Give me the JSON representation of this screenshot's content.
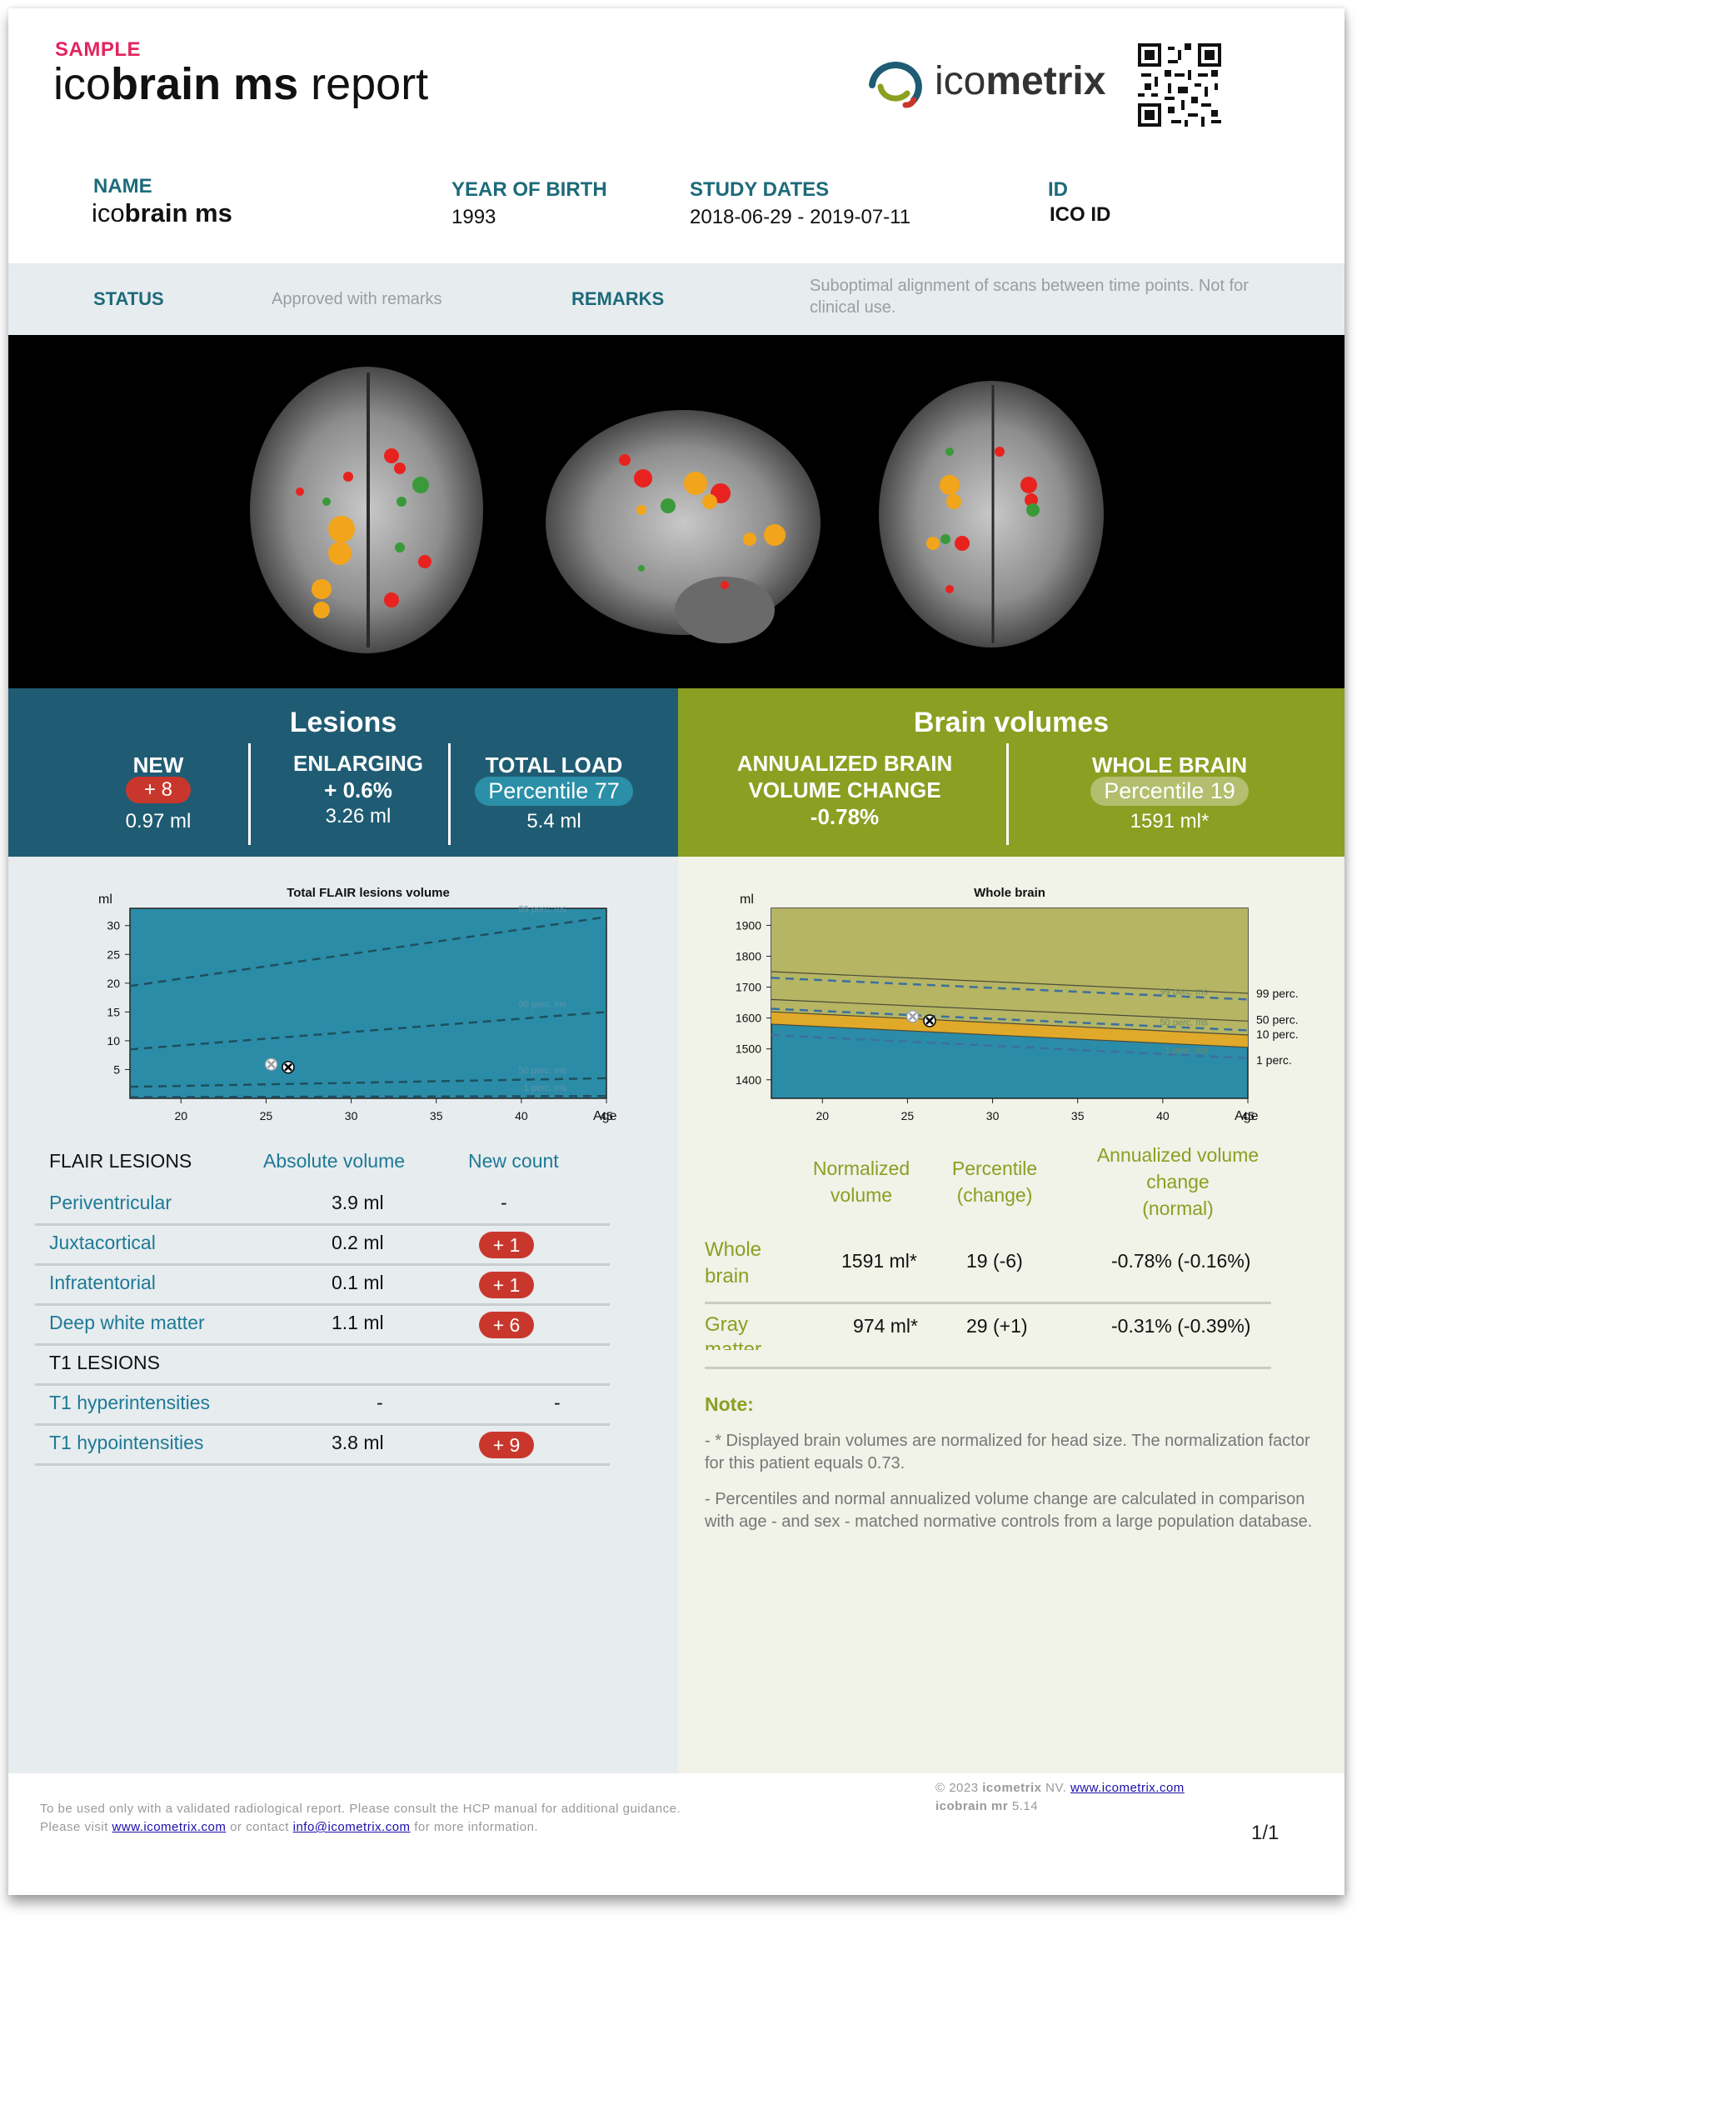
{
  "header": {
    "sample": "SAMPLE",
    "title_light": "ico",
    "title_bold": "brain ms",
    "title_tail": " report",
    "brand_light": "ico",
    "brand_bold": "metrix"
  },
  "patient": {
    "name_label": "NAME",
    "name_light": "ico",
    "name_bold": "brain ms",
    "yob_label": "YEAR OF BIRTH",
    "yob_value": "1993",
    "dates_label": "STUDY DATES",
    "dates_value": "2018-06-29 - 2019-07-11",
    "id_label": "ID",
    "id_value": "ICO ID"
  },
  "status": {
    "status_label": "STATUS",
    "status_value": "Approved with remarks",
    "remarks_label": "REMARKS",
    "remarks_value": "Suboptimal alignment of scans between time points. Not for clinical use."
  },
  "lesions_header": {
    "title": "Lesions",
    "new_label": "NEW",
    "new_badge": "+ 8",
    "new_volume": "0.97 ml",
    "enl_label": "ENLARGING",
    "enl_value": "+ 0.6%",
    "enl_volume": "3.26 ml",
    "total_label": "TOTAL LOAD",
    "total_badge": "Percentile 77",
    "total_volume": "5.4 ml"
  },
  "brain_header": {
    "title": "Brain volumes",
    "abvc_label_1": "ANNUALIZED BRAIN",
    "abvc_label_2": "VOLUME CHANGE",
    "abvc_value": "-0.78%",
    "wb_label": "WHOLE BRAIN",
    "wb_badge": "Percentile 19",
    "wb_volume": "1591 ml*"
  },
  "chart_data": [
    {
      "type": "line",
      "title": "Total FLAIR lesions volume",
      "ylabel": "ml",
      "xlabel": "Age",
      "xlim": [
        17,
        45
      ],
      "ylim": [
        0,
        33
      ],
      "xticks": [
        20,
        25,
        30,
        35,
        40,
        45
      ],
      "yticks": [
        5,
        10,
        15,
        20,
        25,
        30
      ],
      "series": [
        {
          "name": "99 perc. ms",
          "x": [
            17,
            45
          ],
          "y": [
            19.5,
            31.5
          ]
        },
        {
          "name": "90 perc. ms",
          "x": [
            17,
            45
          ],
          "y": [
            8.5,
            15
          ]
        },
        {
          "name": "50 perc. ms",
          "x": [
            17,
            45
          ],
          "y": [
            2,
            3.5
          ]
        },
        {
          "name": "1 perc. ms",
          "x": [
            17,
            45
          ],
          "y": [
            0.2,
            0.4
          ]
        }
      ],
      "points": [
        {
          "x": 25.3,
          "y": 5.9,
          "kind": "previous"
        },
        {
          "x": 26.3,
          "y": 5.4,
          "kind": "current"
        }
      ]
    },
    {
      "type": "line",
      "title": "Whole brain",
      "ylabel": "ml",
      "xlabel": "Age",
      "xlim": [
        17,
        45
      ],
      "ylim": [
        1340,
        1955
      ],
      "xticks": [
        20,
        25,
        30,
        35,
        40,
        45
      ],
      "yticks": [
        1400,
        1500,
        1600,
        1700,
        1800,
        1900
      ],
      "band_labels": [
        "99 perc.",
        "50 perc.",
        "10 perc.",
        "1 perc."
      ],
      "series": [
        {
          "name": "99 perc. ms",
          "x": [
            17,
            45
          ],
          "y": [
            1730,
            1660
          ]
        },
        {
          "name": "50 perc. ms",
          "x": [
            17,
            45
          ],
          "y": [
            1630,
            1560
          ]
        },
        {
          "name": "1 perc. ms",
          "x": [
            17,
            45
          ],
          "y": [
            1545,
            1470
          ]
        }
      ],
      "points": [
        {
          "x": 25.3,
          "y": 1605,
          "kind": "previous"
        },
        {
          "x": 26.3,
          "y": 1591,
          "kind": "current"
        }
      ]
    }
  ],
  "lesion_table": {
    "col_name": "FLAIR LESIONS",
    "col_volume": "Absolute volume",
    "col_count": "New count",
    "rows": [
      {
        "name": "Periventricular",
        "volume": "3.9 ml",
        "count": "-",
        "badge": false
      },
      {
        "name": "Juxtacortical",
        "volume": "0.2 ml",
        "count": "+ 1",
        "badge": true
      },
      {
        "name": "Infratentorial",
        "volume": "0.1 ml",
        "count": "+ 1",
        "badge": true
      },
      {
        "name": "Deep white matter",
        "volume": "1.1 ml",
        "count": "+ 6",
        "badge": true
      }
    ],
    "t1_title": "T1 LESIONS",
    "t1_rows": [
      {
        "name": "T1 hyperintensities",
        "volume": "-",
        "count": "-",
        "badge": false
      },
      {
        "name": "T1 hypointensities",
        "volume": "3.8 ml",
        "count": "+ 9",
        "badge": true
      }
    ]
  },
  "brain_table": {
    "col_norm_1": "Normalized",
    "col_norm_2": "volume",
    "col_perc_1": "Percentile",
    "col_perc_2": "(change)",
    "col_avc_1": "Annualized volume",
    "col_avc_2": "change",
    "col_avc_3": "(normal)",
    "rows": [
      {
        "name_1": "Whole",
        "name_2": "brain",
        "norm": "1591 ml*",
        "perc": "19 (-6)",
        "avc": "-0.78% (-0.16%)"
      },
      {
        "name_1": "Gray",
        "name_2": "matter",
        "norm": "974 ml*",
        "perc": "29 (+1)",
        "avc": "-0.31% (-0.39%)"
      }
    ]
  },
  "note": {
    "title": "Note:",
    "line1": "- * Displayed brain volumes are normalized for head size. The normalization factor for this patient equals 0.73.",
    "line2": "- Percentiles and normal annualized volume change are calculated in comparison with age - and sex - matched normative controls from a large population database."
  },
  "footer": {
    "left_1": "To be used only with a validated radiological report. Please consult the HCP manual for additional guidance.",
    "left_2a": "Please visit ",
    "left_link1": "www.icometrix.com",
    "left_2b": " or contact ",
    "left_link2": "info@icometrix.com",
    "left_2c": " for more information.",
    "right_1a": "© 2023 ",
    "right_1b": "icometrix",
    "right_1c": " NV. ",
    "right_link": "www.icometrix.com",
    "right_2a": "icobrain mr",
    "right_2b": " 5.14",
    "page": "1/1"
  }
}
